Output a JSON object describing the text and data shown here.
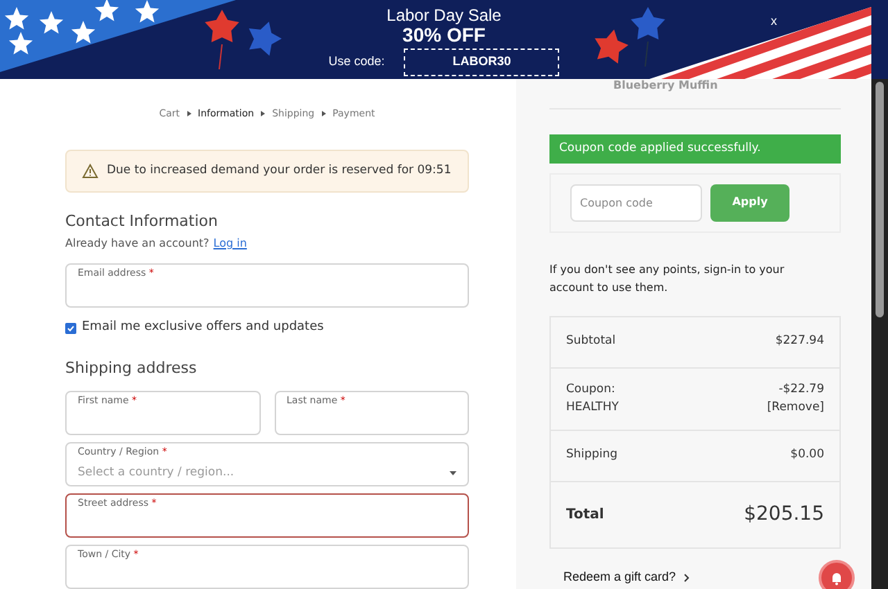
{
  "banner": {
    "title": "Labor Day Sale",
    "offer": "30% OFF",
    "code_label": "Use code:",
    "code": "LABOR30",
    "close": "x"
  },
  "breadcrumb": [
    {
      "label": "Cart",
      "selected": false
    },
    {
      "label": "Information",
      "selected": true
    },
    {
      "label": "Shipping",
      "selected": false
    },
    {
      "label": "Payment",
      "selected": false
    }
  ],
  "notice": "Due to increased demand your order is reserved for 09:51",
  "contact": {
    "heading": "Contact Information",
    "account_text": "Already have an account?",
    "login_link": "Log in",
    "email_label": "Email address",
    "email_mark": "*",
    "newsletter": {
      "label": "Email me exclusive offers and updates",
      "checked": true
    }
  },
  "shipping": {
    "heading": "Shipping address",
    "fields": [
      {
        "label": "First name",
        "mark": "*",
        "kind": "text",
        "error": false
      },
      {
        "label": "Last name",
        "mark": "*",
        "kind": "text",
        "error": false
      },
      {
        "label": "Country / Region",
        "mark": "*",
        "kind": "select",
        "placeholder": "Select a country / region...",
        "error": false
      },
      {
        "label": "Street address",
        "mark": "*",
        "kind": "text",
        "error": true
      },
      {
        "label": "Town / City",
        "mark": "*",
        "kind": "text",
        "error": false
      }
    ]
  },
  "sidebar": {
    "product": "Blueberry Muffin",
    "coupon_message": "Coupon code applied successfully.",
    "coupon_placeholder": "Coupon code",
    "apply": "Apply",
    "points_note": "If you don't see any points, sign-in to your account to use them.",
    "totals": [
      {
        "label": "Subtotal",
        "value": "$227.94",
        "kind": "plain"
      },
      {
        "label": "Coupon:",
        "sublabel": "HEALTHY",
        "value": "-$22.79",
        "action": "[Remove]",
        "kind": "coupon"
      },
      {
        "label": "Shipping",
        "value": "$0.00",
        "kind": "plain"
      },
      {
        "label": "Total",
        "value": "$205.15",
        "kind": "total"
      }
    ],
    "gift_card": "Redeem a gift card?"
  }
}
